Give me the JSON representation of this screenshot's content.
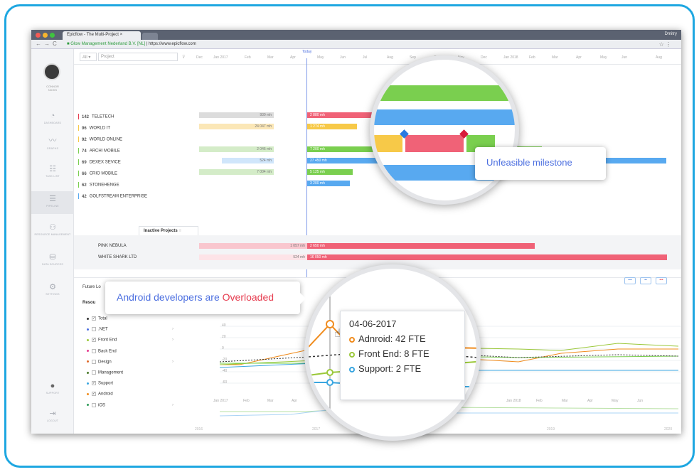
{
  "browser": {
    "tab_title": "Epicflow - The Multi-Project ×",
    "user": "Dmitry",
    "url_secure": "Glow Management Nederland B.V. [NL]",
    "url": "https://www.epicflow.com"
  },
  "sidebar": {
    "user_name": "CONNOR\nNICKS",
    "items": [
      {
        "label": "DASHBOARD",
        "icon": "gauge-icon"
      },
      {
        "label": "GRAPHS",
        "icon": "graph-icon"
      },
      {
        "label": "TASK LIST",
        "icon": "task-list-icon"
      },
      {
        "label": "PIPELINE",
        "icon": "pipeline-icon"
      },
      {
        "label": "RESOURCE MANAGEMENT",
        "icon": "resource-icon"
      },
      {
        "label": "DATA SOURCES",
        "icon": "data-sources-icon"
      },
      {
        "label": "SETTINGS",
        "icon": "settings-icon"
      },
      {
        "label": "SUPPORT",
        "icon": "support-icon"
      },
      {
        "label": "LOGOUT",
        "icon": "logout-icon"
      }
    ]
  },
  "toolbar": {
    "filter_all": "All ▾",
    "filter_project": "Project",
    "today_label": "Today",
    "months": [
      "Dec",
      "Jan 2017",
      "Feb",
      "Mar",
      "Apr",
      "May",
      "Jun",
      "Jul",
      "Aug",
      "Sep",
      "Oct",
      "Nov",
      "Dec",
      "Jan 2018",
      "Feb",
      "Mar",
      "Apr",
      "May",
      "Jun",
      "Aug"
    ]
  },
  "projects": [
    {
      "num": "142",
      "name": "TELETECH",
      "ghost": "930 mh",
      "bar": "2 880 mh"
    },
    {
      "num": "96",
      "name": "WORLD IT",
      "ghost": "24 047 mh",
      "bar": "1 274 mh"
    },
    {
      "num": "92",
      "name": "WORLD ONLINE",
      "ghost": "",
      "bar": ""
    },
    {
      "num": "74",
      "name": "ARCHI MOBILE",
      "ghost": "2 046 mh",
      "bar": "7 200 mh"
    },
    {
      "num": "69",
      "name": "DEXEX SEVICE",
      "ghost": "524 mh",
      "bar": "27 450 mh"
    },
    {
      "num": "66",
      "name": "CRIO MOBILE",
      "ghost": "7 004 mh",
      "bar": "5 125 mh"
    },
    {
      "num": "62",
      "name": "STONEHENGE",
      "ghost": "",
      "bar": "3 200 mh"
    },
    {
      "num": "42",
      "name": "GOLFSTREAM ENTERPRISE",
      "ghost": "",
      "bar": ""
    }
  ],
  "inactive": {
    "tab": "Inactive Projects",
    "rows": [
      {
        "name": "PINK NEBULA",
        "ghost": "1 057 mh",
        "bar": "2 650 mh"
      },
      {
        "name": "WHITE SHARK LTD",
        "ghost": "524 mh",
        "bar": "16 050 mh"
      }
    ]
  },
  "lower": {
    "title": "Future Lo",
    "resources_title": "Resou",
    "resources": [
      {
        "name": "Total",
        "checked": true,
        "color": "#333333"
      },
      {
        "name": ".NET",
        "checked": false,
        "color": "#4c6fe0"
      },
      {
        "name": "Front End",
        "checked": true,
        "color": "#9bc83a"
      },
      {
        "name": "Back End",
        "checked": false,
        "color": "#e63c8f"
      },
      {
        "name": "Design",
        "checked": false,
        "color": "#e06a2a"
      },
      {
        "name": "Management",
        "checked": false,
        "color": "#4a7a2a"
      },
      {
        "name": "Support",
        "checked": true,
        "color": "#3aa6e0"
      },
      {
        "name": "Android",
        "checked": true,
        "color": "#f08c1e"
      },
      {
        "name": "iOS",
        "checked": false,
        "color": "#2e9b5a"
      }
    ],
    "y_ticks": [
      "40",
      "20",
      "0",
      "-20",
      "-40",
      "-60"
    ],
    "x_ticks": [
      "Jan 2017",
      "Feb",
      "Mar",
      "Apr",
      "Jan 2018",
      "Feb",
      "Mar",
      "Apr",
      "May",
      "Jun"
    ],
    "years": [
      "2016",
      "2017",
      "2019",
      "2020"
    ],
    "to_label": "TO"
  },
  "callouts": {
    "android_prefix": "Android developers are ",
    "android_status": "Overloaded",
    "milestone": "Unfeasible milestone"
  },
  "tooltip": {
    "date": "04-06-2017",
    "rows": [
      {
        "label": "Adnroid: 42 FTE",
        "color": "#f08c1e"
      },
      {
        "label": "Front End: 8 FTE",
        "color": "#9bc83a"
      },
      {
        "label": "Support: 2 FTE",
        "color": "#3aa6e0"
      }
    ]
  },
  "colors": {
    "accent": "#1ea7e1",
    "red": "#f06277",
    "green": "#7acf4f",
    "blue": "#58a9f0",
    "yellow": "#f7c948"
  }
}
